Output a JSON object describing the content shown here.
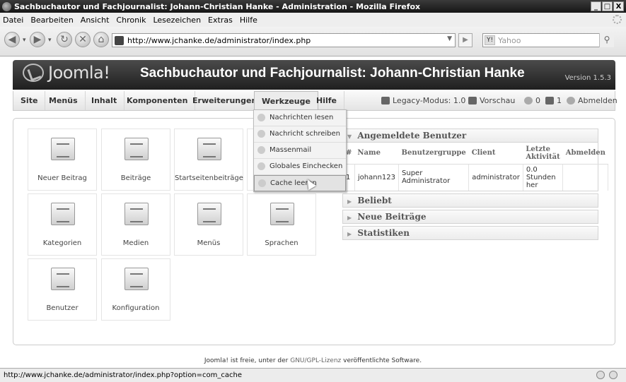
{
  "window": {
    "title": "Sachbuchautor und Fachjournalist: Johann-Christian Hanke - Administration - Mozilla Firefox",
    "buttons": [
      "_",
      "□",
      "X"
    ]
  },
  "browser_menu": [
    "Datei",
    "Bearbeiten",
    "Ansicht",
    "Chronik",
    "Lesezeichen",
    "Extras",
    "Hilfe"
  ],
  "navbar": {
    "url": "http://www.jchanke.de/administrator/index.php",
    "search_engine": "Y!",
    "search_placeholder": "Yahoo"
  },
  "header": {
    "logo_text": "Joomla!",
    "site_title": "Sachbuchautor und Fachjournalist: Johann-Christian Hanke",
    "version": "Version 1.5.3"
  },
  "menu": {
    "items": [
      "Site",
      "Menüs",
      "Inhalt",
      "Komponenten",
      "Erweiterungen",
      "Werkzeuge",
      "Hilfe"
    ],
    "legacy": "Legacy-Modus: 1.0",
    "preview": "Vorschau",
    "messages": "0",
    "users": "1",
    "logout": "Abmelden"
  },
  "dropdown": {
    "items": [
      "Nachrichten lesen",
      "Nachricht schreiben",
      "Massenmail",
      "Globales Einchecken",
      "Cache leeren"
    ]
  },
  "cpanel": {
    "tiles": [
      "Neuer Beitrag",
      "Beiträge",
      "Startseitenbeiträge",
      "",
      "Kategorien",
      "Medien",
      "Menüs",
      "Sprachen",
      "Benutzer",
      "Konfiguration"
    ]
  },
  "panes": {
    "logged_in": {
      "title": "Angemeldete Benutzer",
      "columns": [
        "#",
        "Name",
        "Benutzergruppe",
        "Client",
        "Letzte Aktivität",
        "Abmelden"
      ],
      "row": [
        "1",
        "johann123",
        "Super Administrator",
        "administrator",
        "0.0 Stunden her",
        ""
      ]
    },
    "others": [
      "Beliebt",
      "Neue Beiträge",
      "Statistiken"
    ]
  },
  "footer": {
    "pre": "Joomla!",
    "mid": " ist freie, unter der ",
    "link": "GNU/GPL-Lizenz",
    "post": " veröffentlichte Software."
  },
  "statusbar": {
    "text": "http://www.jchanke.de/administrator/index.php?option=com_cache"
  }
}
